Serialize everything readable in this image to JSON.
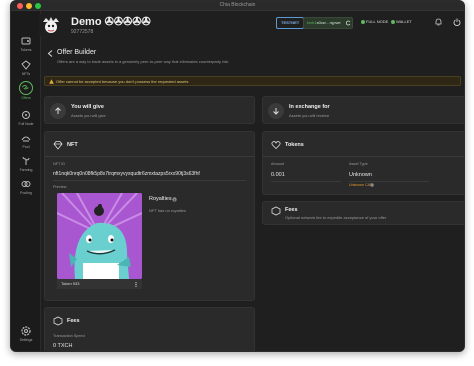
{
  "window": {
    "title": "Chia Blockchain"
  },
  "sidebar": {
    "items": [
      {
        "label": "Tokens",
        "icon": "tokens-icon",
        "active": false
      },
      {
        "label": "NFTs",
        "icon": "nft-icon",
        "active": false
      },
      {
        "label": "Offers",
        "icon": "offers-icon",
        "active": true
      },
      {
        "label": "Full Node",
        "icon": "full-node-icon",
        "active": false
      },
      {
        "label": "Pool",
        "icon": "pool-icon",
        "active": false
      },
      {
        "label": "Farming",
        "icon": "farming-icon",
        "active": false
      },
      {
        "label": "Pooling",
        "icon": "pooling-icon",
        "active": false
      },
      {
        "label": "Settings",
        "icon": "settings-icon",
        "active": false
      }
    ]
  },
  "header": {
    "wallet_name": "Demo ✇✇✇✇✇",
    "fingerprint": "92772578",
    "testnet_label": "TESTNET",
    "address_prefix": "txch1",
    "address_short": "s0cw…rqpwe",
    "full_node_label": "FULL NODE",
    "wallet_label": "WALLET"
  },
  "page": {
    "title": "Offer Builder",
    "subtitle": "Offers are a way to trade assets in a genuinely peer-to-peer way that eliminates counterparty risk.",
    "alert": "Offer cannot be accepted because you don't possess the requested assets"
  },
  "give": {
    "title": "You will give",
    "subtitle": "Assets you will give"
  },
  "receive": {
    "title": "In exchange for",
    "subtitle": "Assets you will receive"
  },
  "nft_card": {
    "title": "NFT",
    "nft_id_label": "NFT ID",
    "nft_id": "nft1nqk0nrq0n08fk5p8x7trqmxyvysqudtr6zmxtazps5rxx90tj3s63fhf",
    "preview_label": "Preview",
    "token_name": "Token 933",
    "royalties_label": "Royalties",
    "royalties_value": "NFT has no royalties"
  },
  "fees_left": {
    "title": "Fees",
    "speed_label": "Transaction Speed",
    "fee_value": "0 TXCH"
  },
  "tokens_card": {
    "title": "Tokens",
    "amount_label": "Amount",
    "amount_value": "0.001",
    "asset_label": "Asset Type",
    "asset_value": "Unknown",
    "asset_note": "Unknown CAT"
  },
  "fees_right": {
    "title": "Fees",
    "subtitle": "Optional network fee to expedite acceptance of your offer"
  },
  "colors": {
    "accent_green": "#5fb85f",
    "testnet_blue": "#7fb2e5",
    "warning": "#e0c27a",
    "unknown_orange": "#e59a2f",
    "nft_bg": "#a957d0"
  }
}
